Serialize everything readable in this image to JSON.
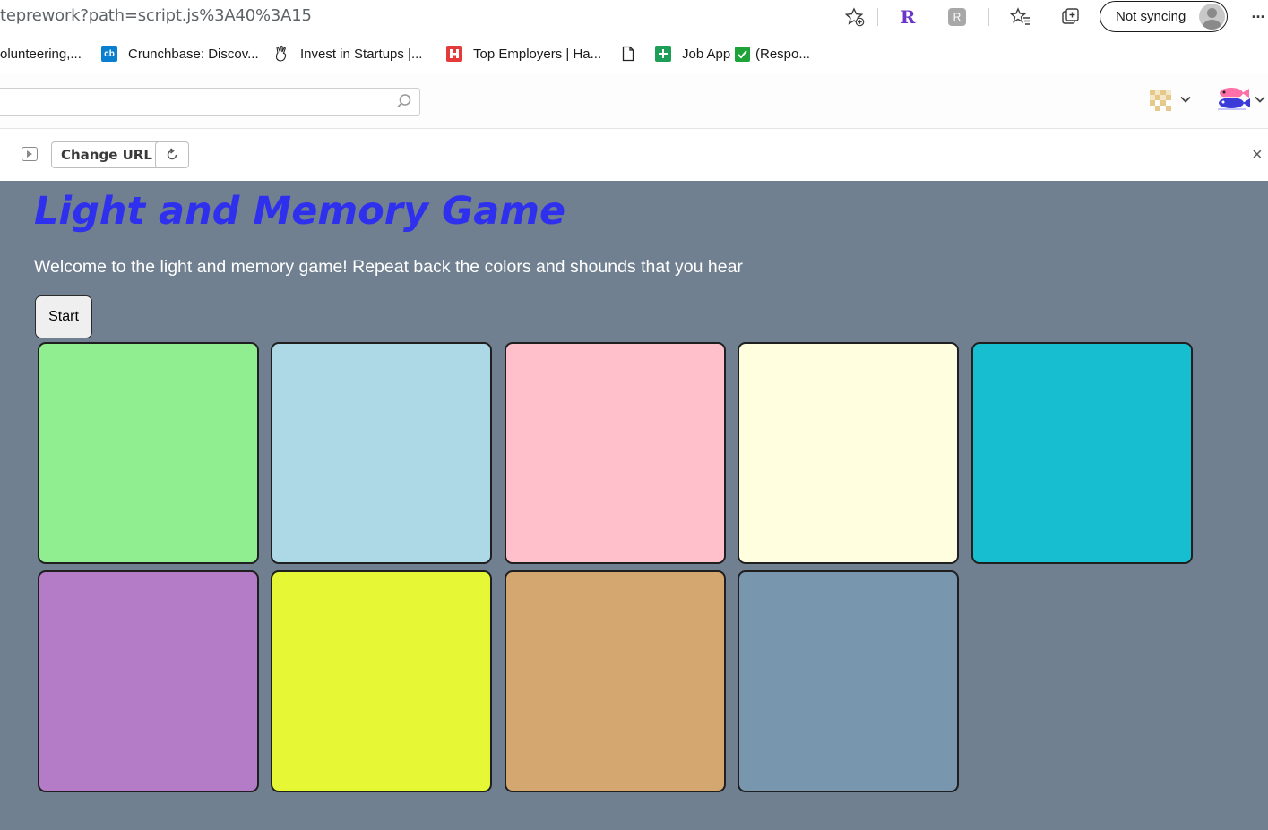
{
  "browser": {
    "address_text": "teprework?path=script.js%3A40%3A15",
    "sync_label": "Not syncing",
    "more_glyph": "···"
  },
  "bookmarks": [
    {
      "label": "olunteering,...",
      "icon": "none"
    },
    {
      "label": "Crunchbase: Discov...",
      "icon": "crunchbase-icon",
      "icon_text": "cb"
    },
    {
      "label": "Invest in Startups |...",
      "icon": "angellist-icon"
    },
    {
      "label": "Top Employers | Ha...",
      "icon": "handshake-icon"
    },
    {
      "label": "",
      "icon": "page-icon"
    },
    {
      "label": "Job App",
      "icon": "sheets-icon"
    },
    {
      "label": "(Respo...",
      "icon": "checkmark-icon"
    }
  ],
  "preview": {
    "change_url_label": "Change URL",
    "close_glyph": "×"
  },
  "game": {
    "title": "Light and Memory Game",
    "welcome": "Welcome to the light and memory game! Repeat back the colors and shounds that you hear",
    "start_label": "Start",
    "background": "#708090",
    "title_color": "#2f30ee"
  },
  "tiles": [
    {
      "name": "tile-1",
      "color": "#90ee90"
    },
    {
      "name": "tile-2",
      "color": "#add8e6"
    },
    {
      "name": "tile-3",
      "color": "#ffc0cb"
    },
    {
      "name": "tile-4",
      "color": "#ffffe0"
    },
    {
      "name": "tile-5",
      "color": "#17becf"
    },
    {
      "name": "tile-6",
      "color": "#b47cc7"
    },
    {
      "name": "tile-7",
      "color": "#e6f736"
    },
    {
      "name": "tile-8",
      "color": "#d5a770"
    },
    {
      "name": "tile-9",
      "color": "#7897ae"
    }
  ]
}
